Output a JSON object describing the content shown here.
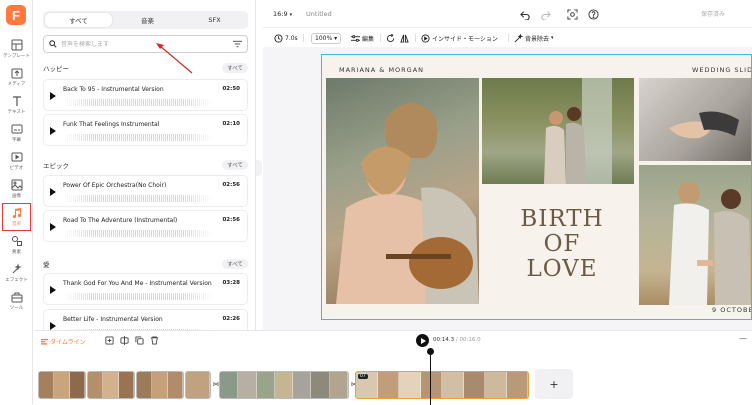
{
  "app": {
    "logo_letter": "F",
    "title": "Untitled",
    "aspect_ratio": "16:9",
    "export_label": "保存済み"
  },
  "rail": {
    "items": [
      {
        "label": "テンプレート",
        "icon": "layout-icon"
      },
      {
        "label": "メディア",
        "icon": "upload-icon"
      },
      {
        "label": "テキスト",
        "icon": "text-icon"
      },
      {
        "label": "字幕",
        "icon": "subtitle-icon"
      },
      {
        "label": "ビデオ",
        "icon": "video-icon"
      },
      {
        "label": "画像",
        "icon": "image-icon"
      },
      {
        "label": "音声",
        "icon": "music-icon",
        "active": true
      },
      {
        "label": "要素",
        "icon": "elements-icon"
      },
      {
        "label": "エフェクト",
        "icon": "effects-icon"
      },
      {
        "label": "ツール",
        "icon": "toolbox-icon"
      }
    ]
  },
  "audio_panel": {
    "tabs": [
      "すべて",
      "音楽",
      "SFX"
    ],
    "active_tab": 0,
    "search_placeholder": "音声を検索します",
    "see_all": "すべて",
    "sections": [
      {
        "title": "ハッピー",
        "tracks": [
          {
            "name": "Back To 95 - Instrumental Version",
            "duration": "02:50"
          },
          {
            "name": "Funk That Feelings Instrumental",
            "duration": "02:10"
          }
        ]
      },
      {
        "title": "エピック",
        "tracks": [
          {
            "name": "Power Of Epic Orchestra(No Choir)",
            "duration": "02:56"
          },
          {
            "name": "Road To The Adventure (Instrumental)",
            "duration": "02:56"
          }
        ]
      },
      {
        "title": "愛",
        "tracks": [
          {
            "name": "Thank God For You And Me - Instrumental Version",
            "duration": "03:28"
          },
          {
            "name": "Better Life - Instrumental Version",
            "duration": "02:26"
          }
        ]
      }
    ]
  },
  "properties": {
    "duration": "7.0s",
    "zoom": "100%",
    "edit_label": "編集",
    "animation_label": "インサイド・モーション",
    "remove_bg_label": "背景除去"
  },
  "slide": {
    "names": "MARIANA & MORGAN",
    "subtitle": "WEDDING SLID",
    "headline": [
      "BIRTH",
      "OF",
      "LOVE"
    ],
    "date": "9 OCTOBE"
  },
  "timeline": {
    "label": "タイムライン",
    "current_time": "00:14.3",
    "total_time": "00:16.0",
    "clip_tag": "07",
    "add_label": "+"
  },
  "colors": {
    "accent": "#ff7a3d",
    "selection": "#35c0d6",
    "highlight_box": "#e63b3b"
  }
}
